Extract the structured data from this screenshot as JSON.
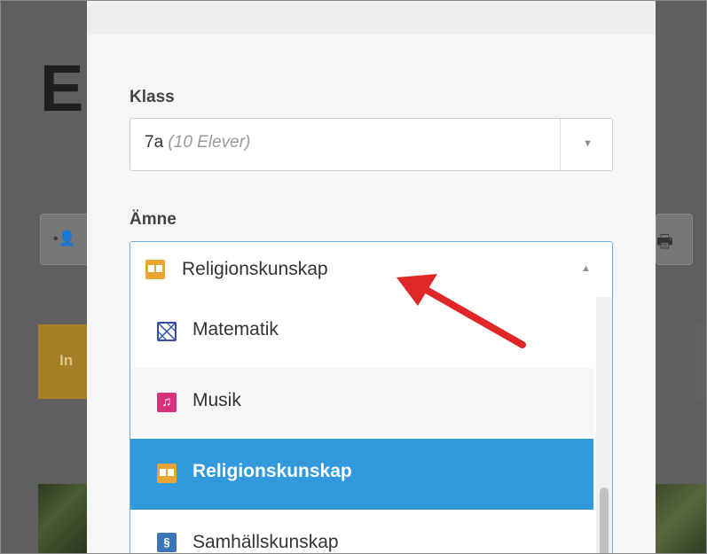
{
  "background": {
    "page_title_initial": "E",
    "gold_button_text": "In"
  },
  "form": {
    "klass": {
      "label": "Klass",
      "value": "7a",
      "value_detail": "(10 Elever)"
    },
    "amne": {
      "label": "Ämne",
      "selected_value": "Religionskunskap",
      "selected_icon": "book-icon",
      "options": [
        {
          "label": "Matematik",
          "icon": "geometry-icon",
          "state": "normal"
        },
        {
          "label": "Musik",
          "icon": "music-note-icon",
          "state": "hover"
        },
        {
          "label": "Religionskunskap",
          "icon": "book-icon",
          "state": "selected"
        },
        {
          "label": "Samhällskunskap",
          "icon": "section-sign-icon",
          "state": "normal"
        }
      ]
    }
  },
  "colors": {
    "selected_bg": "#3399dd",
    "arrow": "#e02626",
    "book_icon": "#e8a531",
    "music_icon": "#d6317d",
    "social_icon": "#3b77b8",
    "math_icon": "#2f4fa8"
  }
}
